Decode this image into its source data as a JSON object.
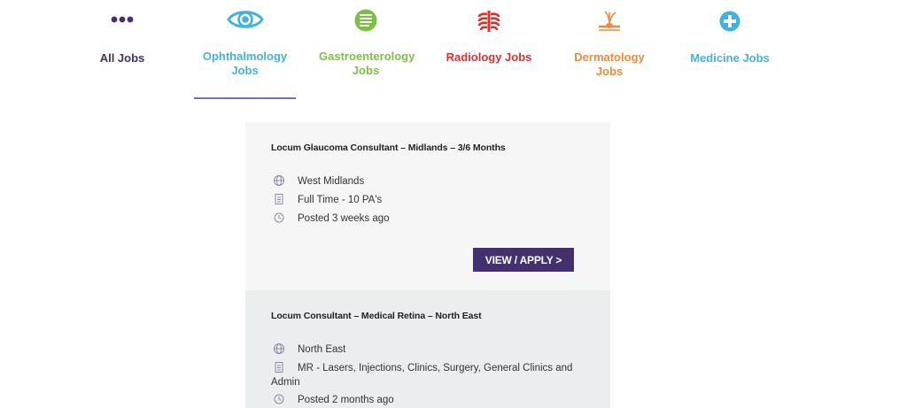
{
  "colors": {
    "all_jobs": "#43306e",
    "ophthalmology": "#3fb3dc",
    "gastro": "#7cc043",
    "radiology": "#d8322f",
    "dermatology": "#ef8a3c",
    "medicine": "#3fb3dc",
    "button_bg": "#43306e",
    "active_underline": "#7d6ab0"
  },
  "tabs": [
    {
      "label": "All Jobs",
      "icon": "dots-icon"
    },
    {
      "label": "Ophthalmology Jobs",
      "icon": "eye-icon"
    },
    {
      "label": "Gastroenterology Jobs",
      "icon": "intestine-icon"
    },
    {
      "label": "Radiology Jobs",
      "icon": "ribcage-icon"
    },
    {
      "label": "Dermatology Jobs",
      "icon": "skin-hair-icon"
    },
    {
      "label": "Medicine Jobs",
      "icon": "plus-circle-icon"
    }
  ],
  "active_tab": "Ophthalmology Jobs",
  "jobs": [
    {
      "title": "Locum Glaucoma Consultant – Midlands – 3/6 Months",
      "location": "West Midlands",
      "type": "Full Time - 10 PA's",
      "posted": "Posted 3 weeks ago",
      "button": "VIEW / APPLY >"
    },
    {
      "title": "Locum Consultant – Medical Retina – North East",
      "location": "North East",
      "type": "MR - Lasers, Injections, Clinics, Surgery, General Clinics and Admin",
      "posted": "Posted 2 months ago"
    }
  ]
}
